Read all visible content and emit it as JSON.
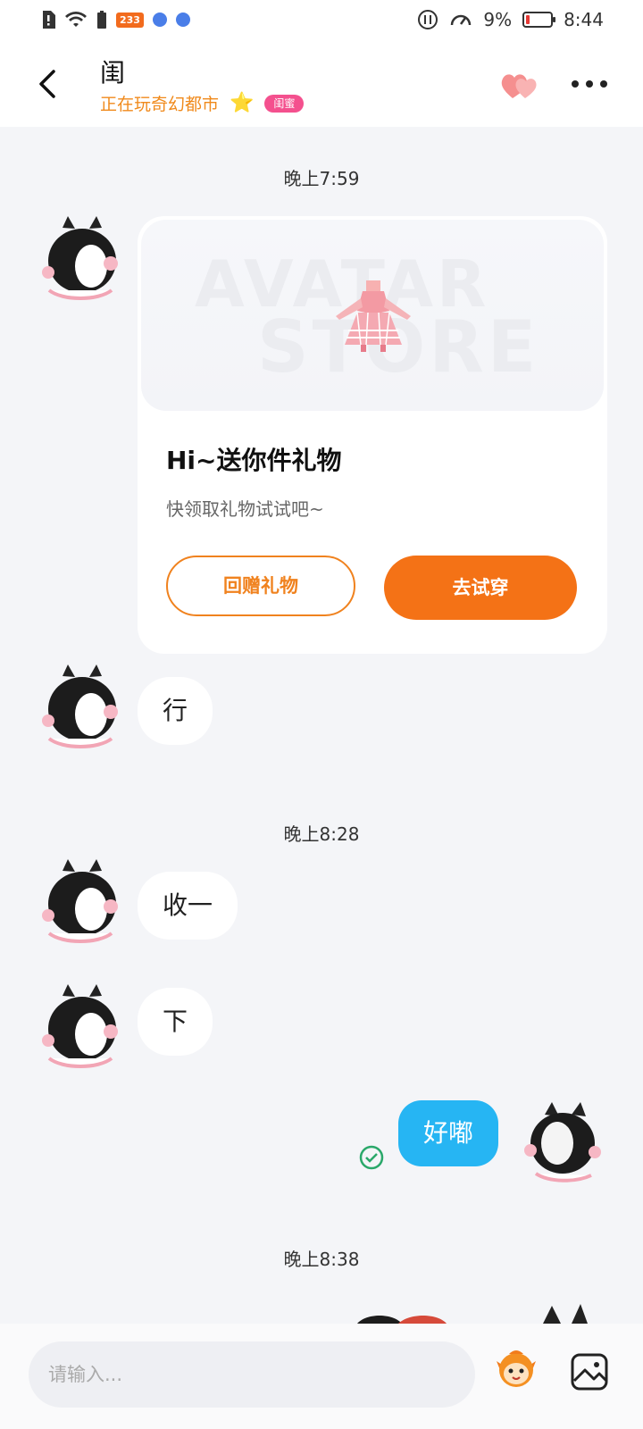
{
  "status_bar": {
    "app_badge": "233",
    "battery_percent": "9%",
    "time": "8:44"
  },
  "header": {
    "title": "闺",
    "subtitle": "正在玩奇幻都市",
    "tag": "闺蜜"
  },
  "messages": {
    "t1": "晚上7:59",
    "gift_card": {
      "bg_text_1": "AVATAR",
      "bg_text_2": "STORE",
      "title": "Hi~送你件礼物",
      "desc": "快领取礼物试试吧~",
      "return_button": "回赠礼物",
      "try_button": "去试穿"
    },
    "m1": "行",
    "t2": "晚上8:28",
    "m2": "收一",
    "m3": "下",
    "m4": "好嘟",
    "t3": "晚上8:38"
  },
  "input_bar": {
    "placeholder": "请输入..."
  },
  "colors": {
    "accent_orange": "#f47216",
    "bubble_blue": "#26b5f3",
    "tag_pink": "#f4508e"
  }
}
